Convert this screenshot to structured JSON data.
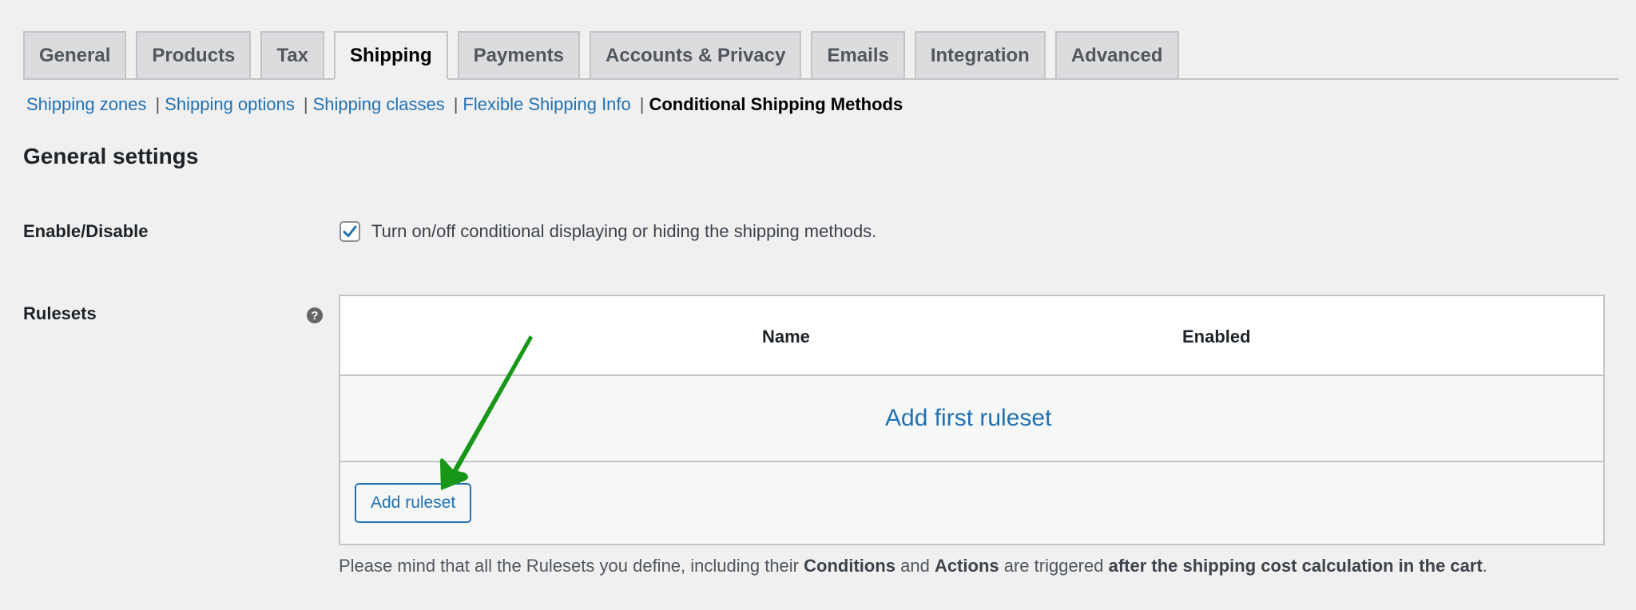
{
  "tabs": [
    {
      "label": "General",
      "active": false
    },
    {
      "label": "Products",
      "active": false
    },
    {
      "label": "Tax",
      "active": false
    },
    {
      "label": "Shipping",
      "active": true
    },
    {
      "label": "Payments",
      "active": false
    },
    {
      "label": "Accounts & Privacy",
      "active": false
    },
    {
      "label": "Emails",
      "active": false
    },
    {
      "label": "Integration",
      "active": false
    },
    {
      "label": "Advanced",
      "active": false
    }
  ],
  "subnav": {
    "links": [
      "Shipping zones",
      "Shipping options",
      "Shipping classes",
      "Flexible Shipping Info"
    ],
    "separator": "|",
    "current": "Conditional Shipping Methods"
  },
  "section_title": "General settings",
  "enable": {
    "label": "Enable/Disable",
    "checked": true,
    "description": "Turn on/off conditional displaying or hiding the shipping methods."
  },
  "rulesets": {
    "label": "Rulesets",
    "help_icon": "?",
    "columns": [
      "Name",
      "Enabled"
    ],
    "empty_link": "Add first ruleset",
    "add_button": "Add ruleset"
  },
  "note": {
    "part1": "Please mind that all the Rulesets you define, including their ",
    "bold1": "Conditions",
    "part2": " and ",
    "bold2": "Actions",
    "part3": " are triggered ",
    "bold3": "after the shipping cost calculation in the cart",
    "part4": "."
  },
  "colors": {
    "link": "#2271b1",
    "annotation_arrow": "#1a9a1a",
    "background": "#f0f0f1"
  }
}
